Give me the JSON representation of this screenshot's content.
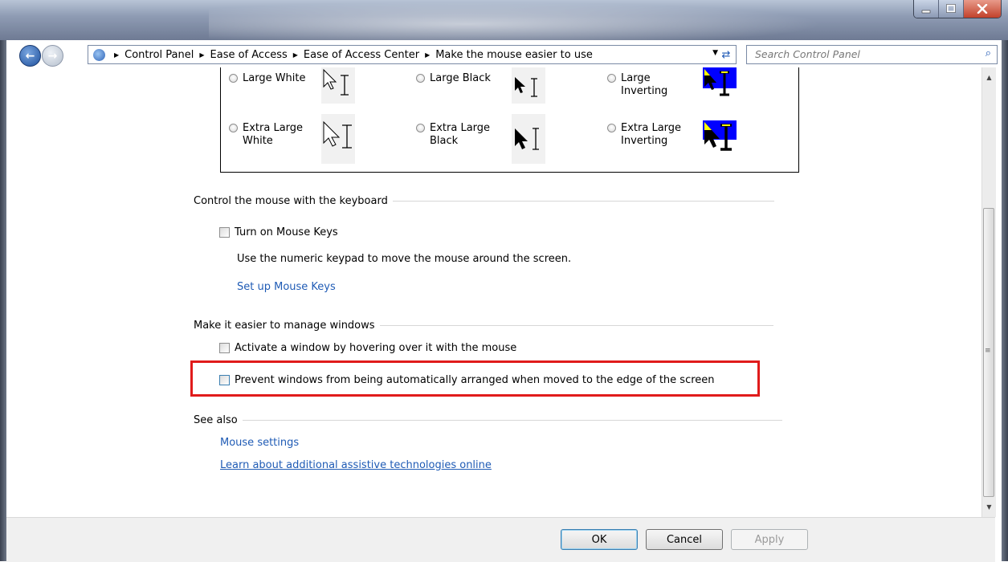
{
  "window": {
    "minimize_icon": "minimize-icon",
    "maximize_icon": "maximize-icon",
    "close_icon": "close-icon"
  },
  "address": {
    "breadcrumbs": [
      "Control Panel",
      "Ease of Access",
      "Ease of Access Center",
      "Make the mouse easier to use"
    ],
    "search_placeholder": "Search Control Panel"
  },
  "pointers": {
    "options": [
      {
        "label_line1": "Large White",
        "label_line2": ""
      },
      {
        "label_line1": "Large Black",
        "label_line2": ""
      },
      {
        "label_line1": "Large",
        "label_line2": "Inverting"
      },
      {
        "label_line1": "Extra Large",
        "label_line2": "White"
      },
      {
        "label_line1": "Extra Large",
        "label_line2": "Black"
      },
      {
        "label_line1": "Extra Large",
        "label_line2": "Inverting"
      }
    ]
  },
  "keyboard_section": {
    "heading": "Control the mouse with the keyboard",
    "mouse_keys_label": "Turn on Mouse Keys",
    "mouse_keys_checked": false,
    "description": "Use the numeric keypad to move the mouse around the screen.",
    "setup_link": "Set up Mouse Keys"
  },
  "windows_section": {
    "heading": "Make it easier to manage windows",
    "hover_label": "Activate a window by hovering over it with the mouse",
    "hover_checked": false,
    "prevent_arrange_label": "Prevent windows from being automatically arranged when moved to the edge of the screen",
    "prevent_arrange_checked": false
  },
  "see_also": {
    "heading": "See also",
    "mouse_settings_link": "Mouse settings",
    "assistive_link": "Learn about additional assistive technologies online"
  },
  "buttons": {
    "ok": "OK",
    "cancel": "Cancel",
    "apply": "Apply"
  },
  "colors": {
    "link": "#1f5bb5",
    "highlight": "#e01b1b",
    "inverting_blue": "#0000ff",
    "inverting_yellow": "#ffff00"
  }
}
